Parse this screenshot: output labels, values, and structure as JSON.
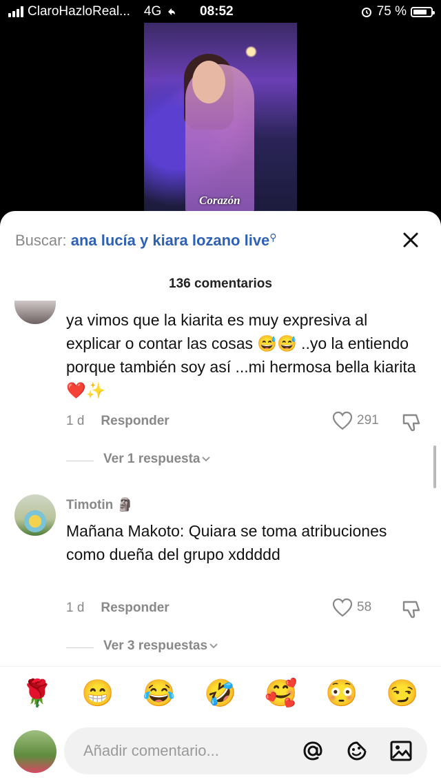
{
  "status_bar": {
    "carrier": "ClaroHazloReal...",
    "network": "4G",
    "time": "08:52",
    "battery": "75 %"
  },
  "video": {
    "caption": "Corazón"
  },
  "header": {
    "search_label": "Buscar:",
    "search_query": "ana lucía y kiara lozano live",
    "comments_count": "136 comentarios"
  },
  "comments": [
    {
      "username": "",
      "text": "ya vimos que la kiarita es muy expresiva al explicar o contar las cosas 😅😅 ..yo la entiendo porque también soy así ...mi hermosa bella kiarita ❤️✨",
      "age": "1 d",
      "reply_label": "Responder",
      "likes": "291",
      "more_replies": "Ver 1 respuesta"
    },
    {
      "username": "Timotin 🗿",
      "text": "Mañana Makoto: Quiara se toma atribuciones como dueña del grupo xddddd",
      "age": "1 d",
      "reply_label": "Responder",
      "likes": "58",
      "more_replies": "Ver 3 respuestas"
    }
  ],
  "emoji_bar": [
    "🌹",
    "😁",
    "😂",
    "🤣",
    "🥰",
    "😳",
    "😏"
  ],
  "composer": {
    "placeholder": "Añadir comentario..."
  },
  "icons": [
    "signal-icon",
    "wifi-icon",
    "alarm-icon",
    "battery-icon",
    "close-icon",
    "heart-icon",
    "dislike-icon",
    "chevron-down-icon",
    "at-icon",
    "emoji-icon",
    "image-icon"
  ],
  "colors": {
    "accent": "#2e60b3",
    "muted": "#888888"
  }
}
